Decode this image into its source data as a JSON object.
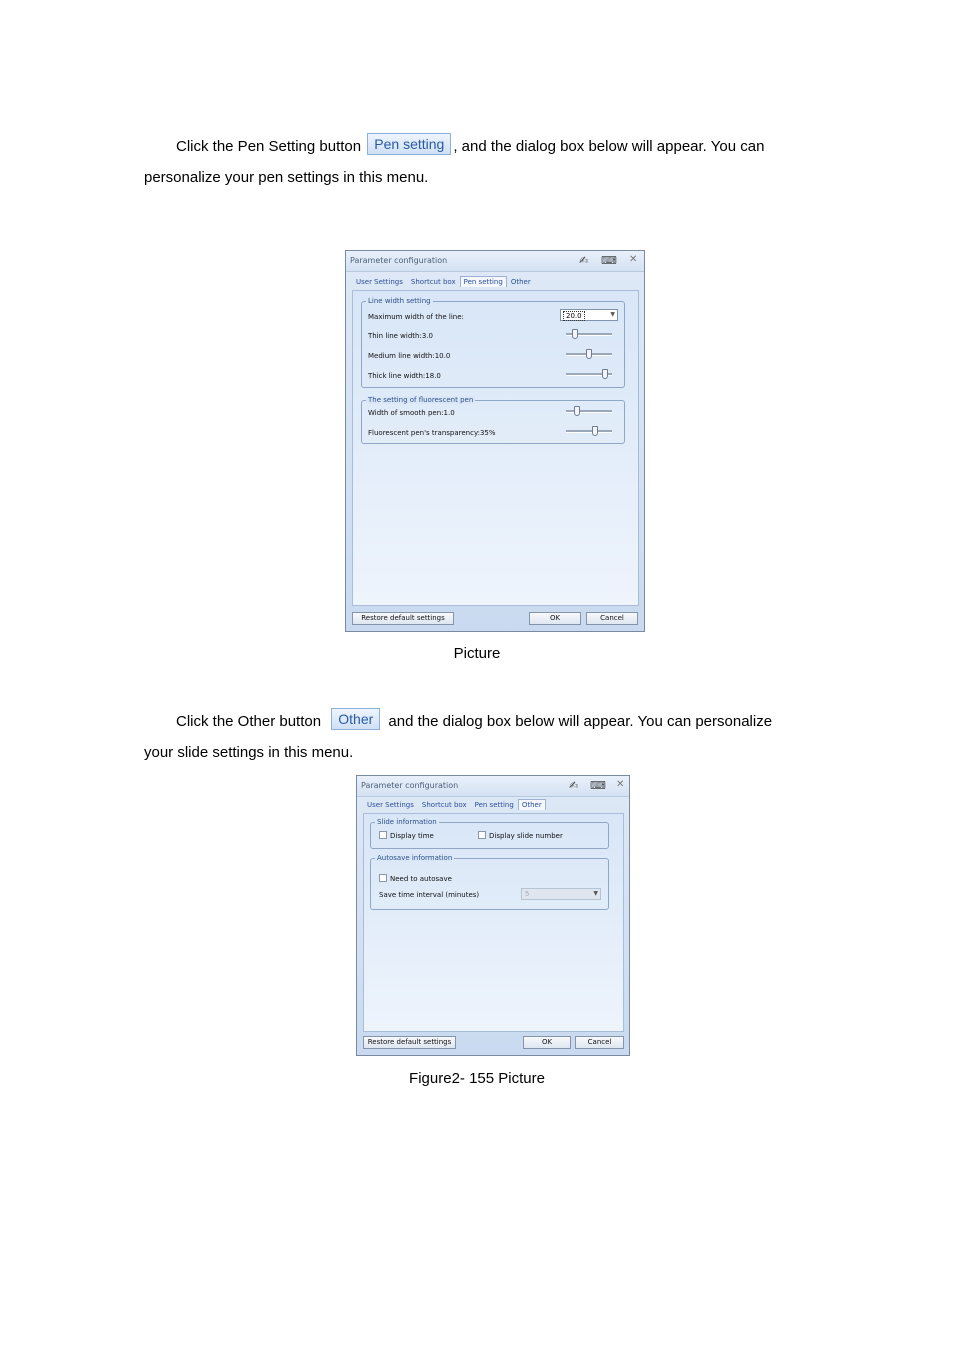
{
  "para1": {
    "line1_before": "Click the Pen Setting button ",
    "button": "Pen setting",
    "line1_after": ", and the dialog box below will appear. You can",
    "line2": "personalize your pen settings in this menu."
  },
  "caption1": "Picture",
  "para2": {
    "line1_before": "Click the Other button ",
    "button": "Other",
    "line1_after": " and the dialog box below will appear. You can personalize",
    "line2": "your slide settings in this menu."
  },
  "caption2": "Figure2- 155 Picture",
  "dialog1": {
    "title": "Parameter configuration",
    "tabs": [
      "User Settings",
      "Shortcut box",
      "Pen setting",
      "Other"
    ],
    "active_tab": "Pen setting",
    "group_line": {
      "label": "Line width setting",
      "max_width_label": "Maximum width of the line:",
      "max_width_value": "20.0",
      "thin_label": "Thin line width:3.0",
      "thin_level": 0.15,
      "medium_label": "Medium line width:10.0",
      "medium_level": 0.5,
      "thick_label": "Thick line width:18.0",
      "thick_level": 0.9
    },
    "group_fluor": {
      "label": "The setting of fluorescent pen",
      "smooth_label": "Width of smooth pen:1.0",
      "smooth_level": 0.2,
      "transparency_label": "Fluorescent pen's transparency:35%",
      "transparency_level": 0.65
    },
    "restore_button": "Restore default settings",
    "ok_button": "OK",
    "cancel_button": "Cancel"
  },
  "dialog2": {
    "title": "Parameter configuration",
    "tabs": [
      "User Settings",
      "Shortcut box",
      "Pen setting",
      "Other"
    ],
    "active_tab": "Other",
    "group_slide": {
      "label": "Slide information",
      "display_time": "Display time",
      "display_slide_number": "Display slide number"
    },
    "group_autosave": {
      "label": "Autosave information",
      "need_autosave": "Need to autosave",
      "interval_label": "Save time interval (minutes)",
      "interval_value": "5"
    },
    "restore_button": "Restore default settings",
    "ok_button": "OK",
    "cancel_button": "Cancel"
  }
}
